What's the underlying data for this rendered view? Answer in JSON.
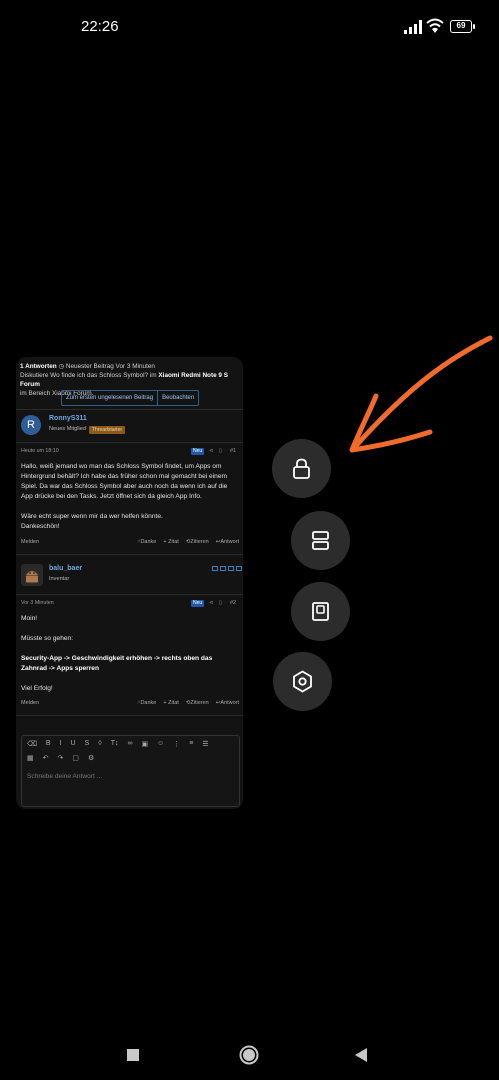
{
  "status": {
    "time": "22:26",
    "battery": "69"
  },
  "thread": {
    "summary_answers": "1 Antworten",
    "summary_latest": "Neuester Beitrag Vor 3 Minuten",
    "summary_line2_prefix": "Diskutiere Wo finde ich das Schloss Symbol? im ",
    "summary_forum": "Xiaomi Redmi Note 9 S Forum",
    "summary_line3": "im Bereich Xiaomi Forum.",
    "buttons": [
      "Zum ersten ungelesenen Beitrag",
      "Beobachten"
    ]
  },
  "posts": [
    {
      "avatar_letter": "R",
      "author": "RonnyS311",
      "role": "Neues Mitglied",
      "tag": "Threadstarter",
      "time": "Heute um 18:10",
      "badge": "Neu",
      "number": "#1",
      "paragraphs": [
        "Hallo, weiß jemand wo man das Schloss Symbol findet, um Apps om Hintergrund behält? Ich habe das früher schon mal gemacht bei einem Spiel. Da war das Schloss Symbol aber auch noch da wenn ich auf die App drücke bei den Tasks. Jetzt öffnet sich da gleich App Info.",
        "Wäre echt super wenn mir da wer helfen könnte.",
        "Dankeschön!"
      ]
    },
    {
      "author": "balu_baer",
      "role": "Inventar",
      "time": "Vor 3 Minuten",
      "badge": "Neu",
      "number": "#2",
      "p1": "Moin!",
      "p2": "Müsste so gehen:",
      "p3": "Security-App -> Geschwindigkeit erhöhen -> rechts oben das Zahnrad -> Apps sperren",
      "p4": "Viel Erfolg!"
    }
  ],
  "post_actions": {
    "report": "Melden",
    "thanks": "Danke",
    "quote": "+ Zitat",
    "cite": "Zitieren",
    "reply": "Antwort"
  },
  "editor": {
    "placeholder": "Schreibe deine Antwort ...",
    "toolbar": [
      "B",
      "I",
      "U",
      "S",
      "T↕"
    ]
  },
  "floating_buttons": [
    "lock-icon",
    "split-screen-icon",
    "small-window-icon",
    "settings-icon"
  ],
  "annotation_color": "#f26b2a"
}
